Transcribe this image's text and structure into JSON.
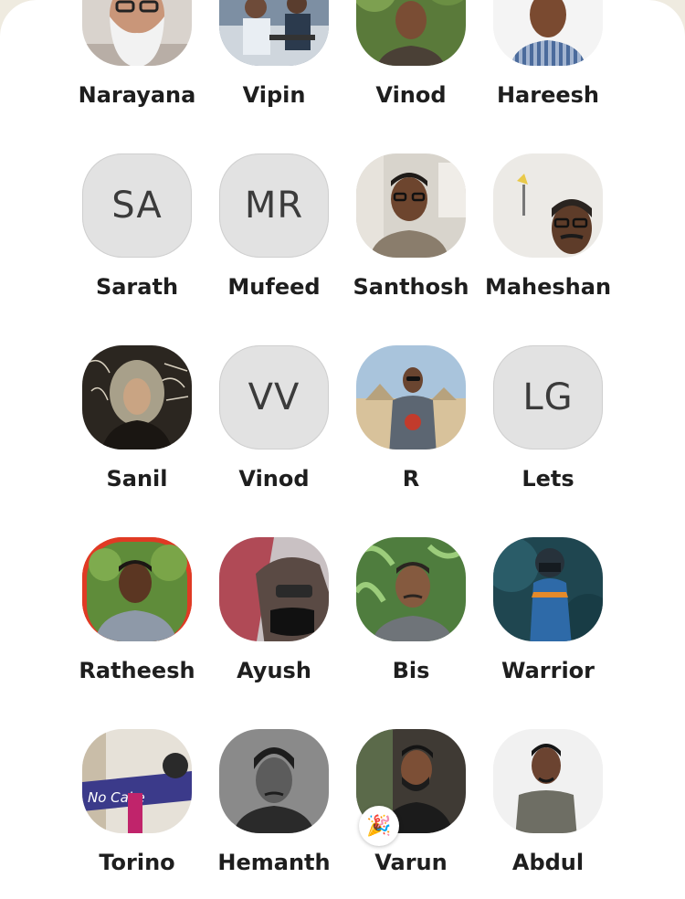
{
  "contacts": [
    {
      "name": "Narayana",
      "kind": "photo"
    },
    {
      "name": "Vipin",
      "kind": "photo"
    },
    {
      "name": "Vinod",
      "kind": "photo"
    },
    {
      "name": "Hareesh",
      "kind": "photo"
    },
    {
      "name": "Sarath",
      "kind": "initials",
      "initials": "SA"
    },
    {
      "name": "Mufeed",
      "kind": "initials",
      "initials": "MR"
    },
    {
      "name": "Santhosh",
      "kind": "photo"
    },
    {
      "name": "Maheshan",
      "kind": "photo"
    },
    {
      "name": "Sanil",
      "kind": "photo"
    },
    {
      "name": "Vinod",
      "kind": "initials",
      "initials": "VV"
    },
    {
      "name": "R",
      "kind": "photo"
    },
    {
      "name": "Lets",
      "kind": "initials",
      "initials": "LG"
    },
    {
      "name": "Ratheesh",
      "kind": "photo",
      "status_ring": true
    },
    {
      "name": "Ayush",
      "kind": "photo"
    },
    {
      "name": "Bis",
      "kind": "photo"
    },
    {
      "name": "Warrior",
      "kind": "photo"
    },
    {
      "name": "Torino",
      "kind": "photo"
    },
    {
      "name": "Hemanth",
      "kind": "photo"
    },
    {
      "name": "Varun",
      "kind": "photo",
      "badge": "party-popper-icon"
    },
    {
      "name": "Abdul",
      "kind": "photo"
    }
  ],
  "photo_texts": {
    "torino_sticker": "No Cake"
  },
  "colors": {
    "background": "#efebe0",
    "sheet": "#ffffff",
    "initials_bg": "#e2e2e2",
    "status_ring": "#e03a24"
  }
}
